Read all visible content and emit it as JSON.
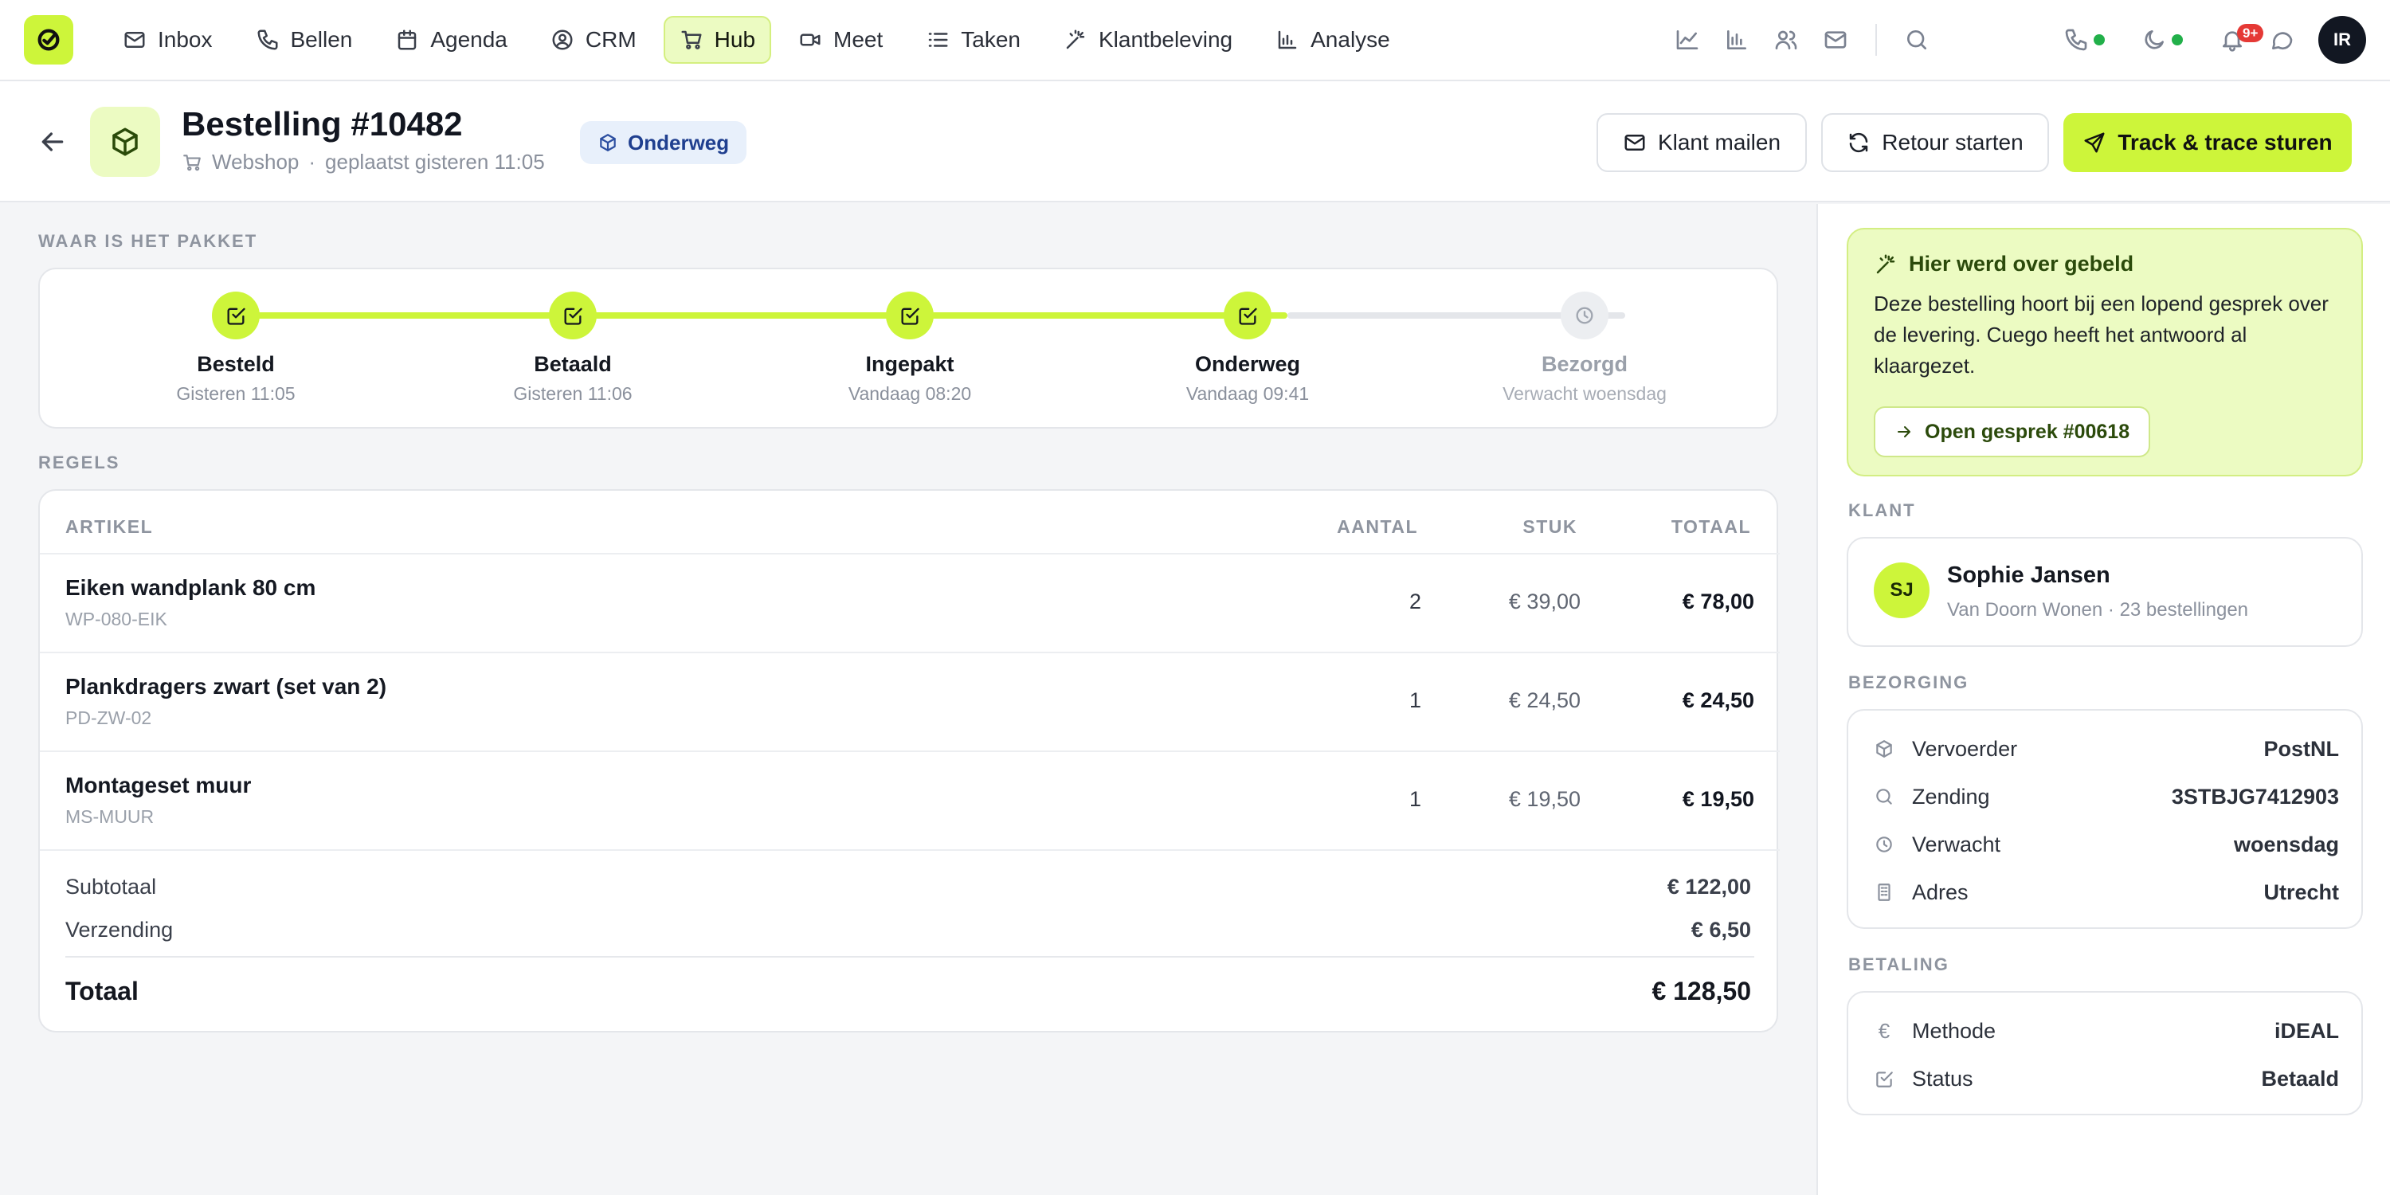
{
  "nav": {
    "items": [
      {
        "label": "Inbox",
        "icon": "mail-icon"
      },
      {
        "label": "Bellen",
        "icon": "phone-icon"
      },
      {
        "label": "Agenda",
        "icon": "calendar-icon"
      },
      {
        "label": "CRM",
        "icon": "user-circle-icon"
      },
      {
        "label": "Hub",
        "icon": "cart-icon"
      },
      {
        "label": "Meet",
        "icon": "video-icon"
      },
      {
        "label": "Taken",
        "icon": "list-icon"
      },
      {
        "label": "Klantbeleving",
        "icon": "sparkle-wand-icon"
      },
      {
        "label": "Analyse",
        "icon": "bar-chart-icon"
      }
    ],
    "active": "Hub",
    "notification_badge": "9+",
    "user_initials": "IR"
  },
  "order": {
    "title": "Bestelling #10482",
    "channel": "Webshop",
    "separator": "·",
    "placed": "geplaatst gisteren 11:05",
    "status": "Onderweg",
    "actions": {
      "mail": "Klant mailen",
      "return": "Retour starten",
      "track": "Track & trace sturen"
    }
  },
  "tracking": {
    "section_label": "WAAR IS HET PAKKET",
    "steps": [
      {
        "name": "Besteld",
        "time": "Gisteren 11:05",
        "done": true
      },
      {
        "name": "Betaald",
        "time": "Gisteren 11:06",
        "done": true
      },
      {
        "name": "Ingepakt",
        "time": "Vandaag 08:20",
        "done": true
      },
      {
        "name": "Onderweg",
        "time": "Vandaag 09:41",
        "done": true
      },
      {
        "name": "Bezorgd",
        "time": "Verwacht woensdag",
        "done": false
      }
    ]
  },
  "lines": {
    "section_label": "REGELS",
    "headers": {
      "article": "ARTIKEL",
      "qty": "AANTAL",
      "unit": "STUK",
      "total": "TOTAAL"
    },
    "rows": [
      {
        "name": "Eiken wandplank 80 cm",
        "sku": "WP-080-EIK",
        "qty": "2",
        "unit": "€ 39,00",
        "total": "€ 78,00"
      },
      {
        "name": "Plankdragers zwart (set van 2)",
        "sku": "PD-ZW-02",
        "qty": "1",
        "unit": "€ 24,50",
        "total": "€ 24,50"
      },
      {
        "name": "Montageset muur",
        "sku": "MS-MUUR",
        "qty": "1",
        "unit": "€ 19,50",
        "total": "€ 19,50"
      }
    ],
    "subtotal_label": "Subtotaal",
    "subtotal": "€ 122,00",
    "shipping_label": "Verzending",
    "shipping": "€ 6,50",
    "total_label": "Totaal",
    "total": "€ 128,50"
  },
  "hint": {
    "title": "Hier werd over gebeld",
    "text": "Deze bestelling hoort bij een lopend gesprek over de levering. Cuego heeft het antwoord al klaargezet.",
    "button": "Open gesprek #00618"
  },
  "customer": {
    "section_label": "KLANT",
    "initials": "SJ",
    "name": "Sophie Jansen",
    "sub": "Van Doorn Wonen · 23 bestellingen"
  },
  "delivery": {
    "section_label": "BEZORGING",
    "rows": [
      {
        "key": "Vervoerder",
        "value": "PostNL",
        "icon": "box-icon"
      },
      {
        "key": "Zending",
        "value": "3STBJG7412903",
        "icon": "search-icon"
      },
      {
        "key": "Verwacht",
        "value": "woensdag",
        "icon": "clock-icon"
      },
      {
        "key": "Adres",
        "value": "Utrecht",
        "icon": "building-icon"
      }
    ]
  },
  "payment": {
    "section_label": "BETALING",
    "rows": [
      {
        "key": "Methode",
        "value": "iDEAL",
        "icon": "euro-icon",
        "symbol": "€"
      },
      {
        "key": "Status",
        "value": "Betaald",
        "icon": "checkbox-icon"
      }
    ]
  },
  "colors": {
    "accent": "#cdf53a",
    "accent_soft": "#ecfbc2",
    "status_blue_bg": "#e8f0fb",
    "status_blue_text": "#1f3f8f",
    "online_green": "#22b04a",
    "badge_red": "#e53935"
  }
}
